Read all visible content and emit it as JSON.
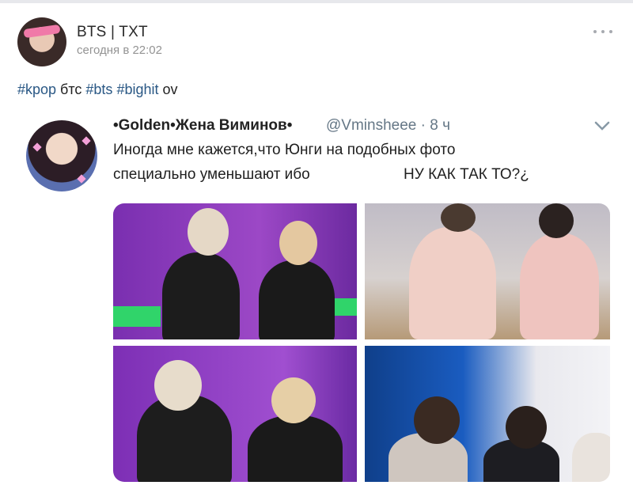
{
  "post": {
    "author": "BTS | TXT",
    "time": "сегодня в 22:02",
    "avatar_text": "",
    "text_parts": [
      {
        "text": "#kpop",
        "tag": true
      },
      {
        "text": " бтс ",
        "tag": false
      },
      {
        "text": "#bts",
        "tag": true
      },
      {
        "text": " ",
        "tag": false
      },
      {
        "text": "#bighit",
        "tag": true
      },
      {
        "text": " ov",
        "tag": false
      }
    ]
  },
  "tweet": {
    "name": "•Golden•Жена Виминов•",
    "handle": "@Vminsheee · 8 ч",
    "line1": "Иногда мне кажется,что Юнги на подобных фото",
    "line2": "специально уменьшают ибо",
    "line2_tail": "НУ КАК ТАК ТО?¿"
  },
  "colors": {
    "hashtag": "#2a5885",
    "secondary_text": "#939393",
    "tweet_handle": "#657786"
  },
  "icons": {
    "menu": "more-horizontal-icon",
    "tweet_menu": "chevron-down-icon"
  }
}
